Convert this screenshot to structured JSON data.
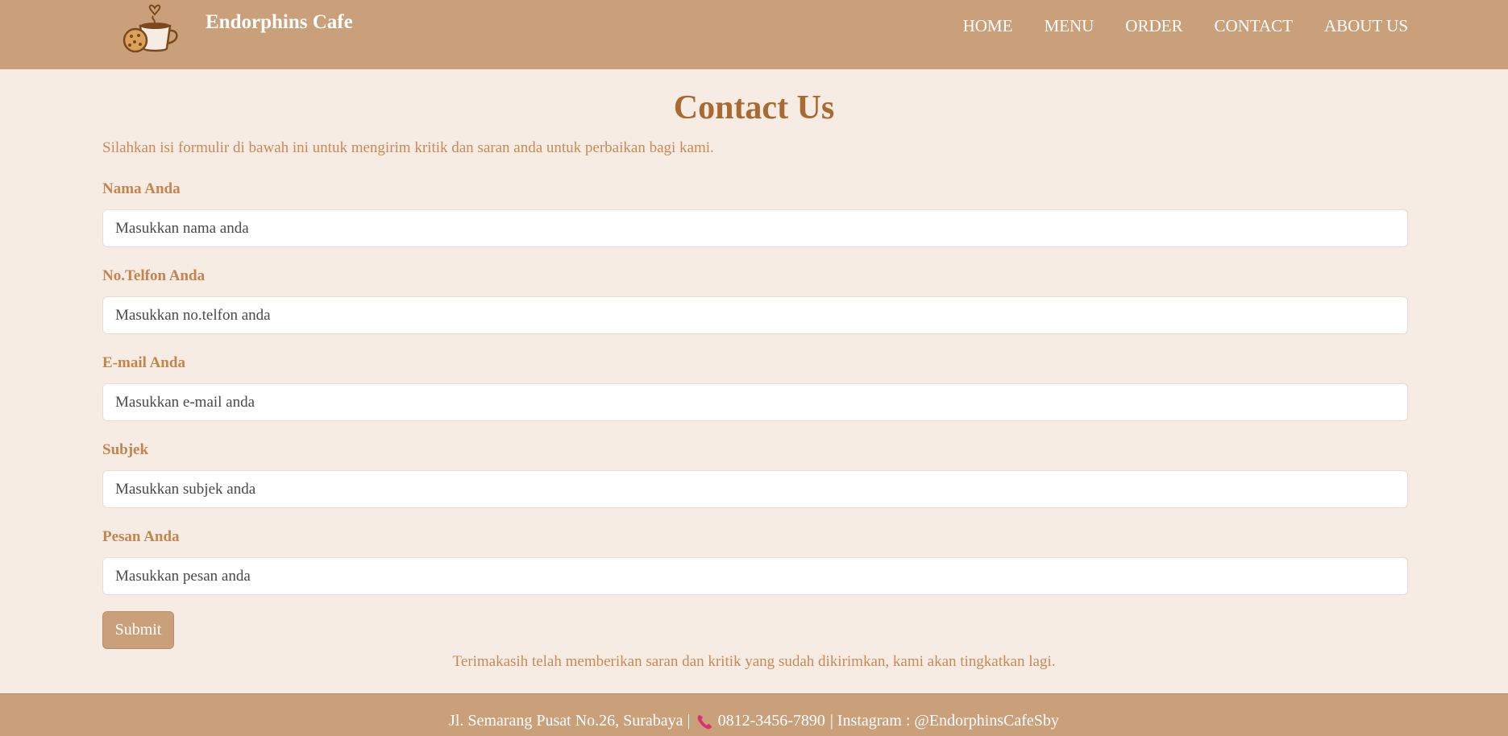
{
  "header": {
    "brand": "Endorphins Cafe",
    "logo_icon": "coffee-cup-cookie-icon",
    "nav": [
      "HOME",
      "MENU",
      "ORDER",
      "CONTACT",
      "ABOUT US"
    ]
  },
  "main": {
    "title": "Contact Us",
    "intro": "Silahkan isi formulir di bawah ini untuk mengirim kritik dan saran anda untuk perbaikan bagi kami.",
    "fields": [
      {
        "label": "Nama Anda",
        "placeholder": "Masukkan nama anda",
        "value": ""
      },
      {
        "label": "No.Telfon Anda",
        "placeholder": "Masukkan no.telfon anda",
        "value": ""
      },
      {
        "label": "E-mail Anda",
        "placeholder": "Masukkan e-mail anda",
        "value": ""
      },
      {
        "label": "Subjek",
        "placeholder": "Masukkan subjek anda",
        "value": ""
      },
      {
        "label": "Pesan Anda",
        "placeholder": "Masukkan pesan anda",
        "value": ""
      }
    ],
    "submit_label": "Submit",
    "thanks": "Terimakasih telah memberikan saran dan kritik yang sudah dikirimkan, kami akan tingkatkan lagi."
  },
  "footer": {
    "address": "Jl. Semarang Pusat No.26, Surabaya |",
    "phone_icon": "telephone-icon",
    "phone": "0812-3456-7890",
    "instagram": "| Instagram : @EndorphinsCafeSby"
  },
  "colors": {
    "header_bg": "#c9a07a",
    "page_bg": "#f6ece3",
    "title": "#a86a32",
    "text_accent": "#c98a55"
  }
}
